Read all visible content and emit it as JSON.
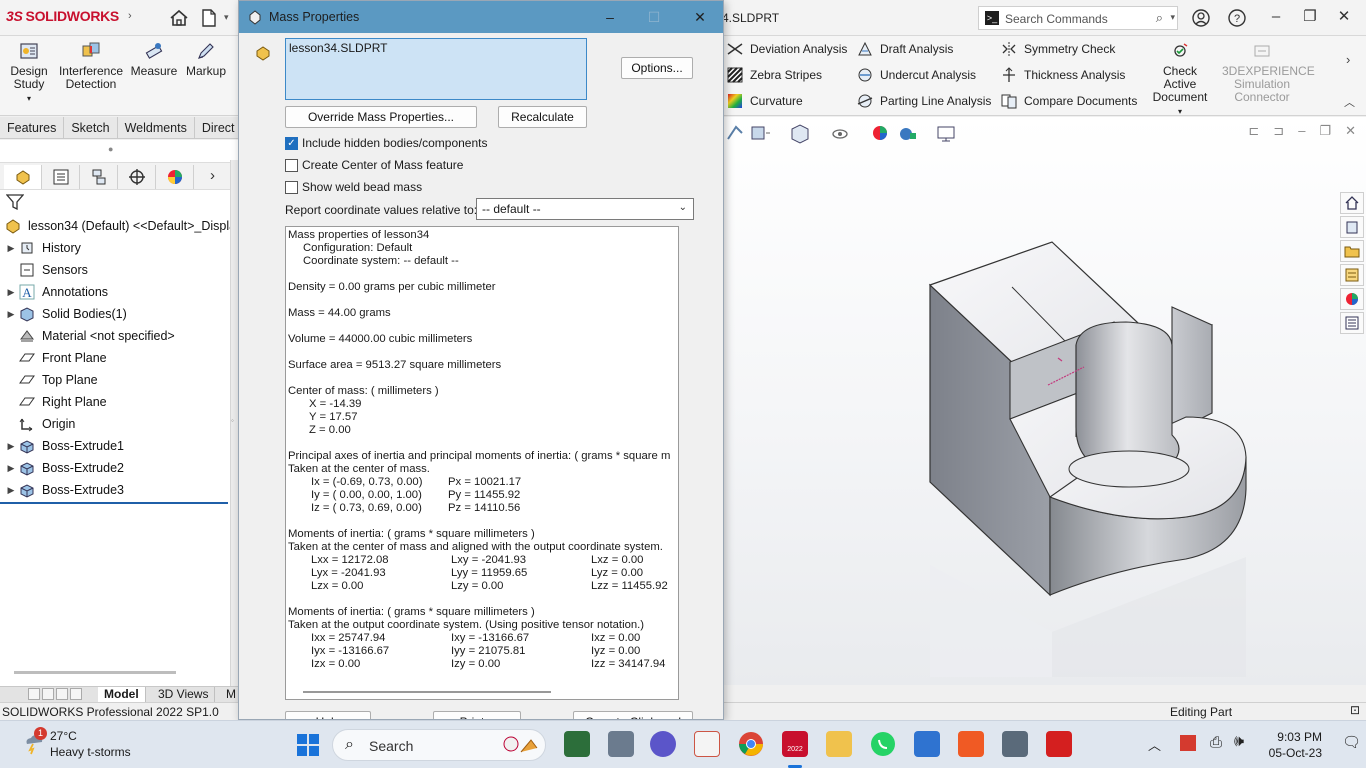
{
  "titlebar": {
    "brand_ds": "3S",
    "brand_name": "SOLIDWORKS",
    "document_title": "4.SLDPRT",
    "search_placeholder": "Search Commands"
  },
  "ribbon": {
    "left_buttons": [
      {
        "label1": "Design",
        "label2": "Study",
        "icon": "design-study-icon"
      },
      {
        "label1": "Interference",
        "label2": "Detection",
        "icon": "interference-detection-icon"
      },
      {
        "label1": "Measure",
        "label2": "",
        "icon": "measure-icon"
      },
      {
        "label1": "Markup",
        "label2": "",
        "icon": "markup-icon"
      }
    ],
    "tools": {
      "deviation": "Deviation Analysis",
      "draft": "Draft Analysis",
      "symmetry": "Symmetry Check",
      "zebra": "Zebra Stripes",
      "undercut": "Undercut Analysis",
      "thickness": "Thickness Analysis",
      "curvature": "Curvature",
      "parting": "Parting Line Analysis",
      "compare": "Compare Documents"
    },
    "check_active_1": "Check Active",
    "check_active_2": "Document",
    "sim_1": "3DEXPERIENCE",
    "sim_2": "Simulation",
    "sim_3": "Connector"
  },
  "command_tabs": [
    "Features",
    "Sketch",
    "Weldments",
    "Direct E"
  ],
  "feature_tree": {
    "root": "lesson34 (Default) <<Default>_Display",
    "items": [
      {
        "label": "History",
        "expandable": true,
        "icon": "history-icon"
      },
      {
        "label": "Sensors",
        "expandable": false,
        "icon": "sensors-icon"
      },
      {
        "label": "Annotations",
        "expandable": true,
        "icon": "annotations-icon"
      },
      {
        "label": "Solid Bodies(1)",
        "expandable": true,
        "icon": "solid-bodies-icon"
      },
      {
        "label": "Material <not specified>",
        "expandable": false,
        "icon": "material-icon"
      },
      {
        "label": "Front Plane",
        "expandable": false,
        "icon": "plane-icon"
      },
      {
        "label": "Top Plane",
        "expandable": false,
        "icon": "plane-icon"
      },
      {
        "label": "Right Plane",
        "expandable": false,
        "icon": "plane-icon"
      },
      {
        "label": "Origin",
        "expandable": false,
        "icon": "origin-icon"
      },
      {
        "label": "Boss-Extrude1",
        "expandable": true,
        "icon": "extrude-icon"
      },
      {
        "label": "Boss-Extrude2",
        "expandable": true,
        "icon": "extrude-icon"
      },
      {
        "label": "Boss-Extrude3",
        "expandable": true,
        "icon": "extrude-icon"
      }
    ]
  },
  "bottom_tabs": [
    "Model",
    "3D Views",
    "M"
  ],
  "status": {
    "left": "SOLIDWORKS Professional 2022 SP1.0",
    "right": "Editing Part"
  },
  "dialog": {
    "title": "Mass Properties",
    "selection": "lesson34.SLDPRT",
    "options_btn": "Options...",
    "override_btn": "Override Mass Properties...",
    "recalc_btn": "Recalculate",
    "check_hidden": "Include hidden bodies/components",
    "check_com": "Create Center of Mass feature",
    "check_weld": "Show weld bead mass",
    "coord_label": "Report coordinate values relative to:",
    "coord_value": "-- default --",
    "bottom_buttons": [
      "Help",
      "Print...",
      "Copy to Clipboard"
    ],
    "results": {
      "header": "Mass properties of lesson34",
      "config": "Configuration: Default",
      "coordsys": "Coordinate system: -- default --",
      "density": "Density = 0.00 grams per cubic millimeter",
      "mass": "Mass = 44.00 grams",
      "volume": "Volume = 44000.00 cubic millimeters",
      "surface": "Surface area = 9513.27  square millimeters",
      "com_header": "Center of mass: ( millimeters )",
      "com_x": "X = -14.39",
      "com_y": "Y = 17.57",
      "com_z": "Z = 0.00",
      "pa_header": "Principal axes of inertia and principal moments of inertia: ( grams *  square m",
      "pa_taken": "Taken at the center of mass.",
      "pa_rows": [
        [
          "Ix = (-0.69,  0.73,  0.00)",
          "Px = 10021.17"
        ],
        [
          "Iy = ( 0.00,  0.00,  1.00)",
          "Py = 11455.92"
        ],
        [
          "Iz = ( 0.73,  0.69,  0.00)",
          "Pz = 14110.56"
        ]
      ],
      "moi1_header": "Moments of inertia: ( grams *  square millimeters )",
      "moi1_taken": "Taken at the center of mass and aligned with the output coordinate system.",
      "moi1_rows": [
        [
          "Lxx = 12172.08",
          "Lxy = -2041.93",
          "Lxz = 0.00"
        ],
        [
          "Lyx = -2041.93",
          "Lyy = 11959.65",
          "Lyz = 0.00"
        ],
        [
          "Lzx = 0.00",
          "Lzy = 0.00",
          "Lzz = 11455.92"
        ]
      ],
      "moi2_header": "Moments of inertia: ( grams *  square millimeters )",
      "moi2_taken": "Taken at the output coordinate system. (Using positive tensor notation.)",
      "moi2_rows": [
        [
          "Ixx = 25747.94",
          "Ixy = -13166.67",
          "Ixz = 0.00"
        ],
        [
          "Iyx = -13166.67",
          "Iyy = 21075.81",
          "Iyz = 0.00"
        ],
        [
          "Izx = 0.00",
          "Izy = 0.00",
          "Izz = 34147.94"
        ]
      ]
    }
  },
  "taskbar": {
    "weather_temp": "27°C",
    "weather_desc": "Heavy t-storms",
    "weather_badge": "1",
    "search_placeholder": "Search",
    "sw_badge": "2022",
    "time": "9:03 PM",
    "date": "05-Oct-23"
  },
  "colors": {
    "accent": "#1f6fbf",
    "dialog_title": "#5b99c2",
    "selection_bg": "#cde3f5",
    "brand_red": "#c8102e"
  }
}
